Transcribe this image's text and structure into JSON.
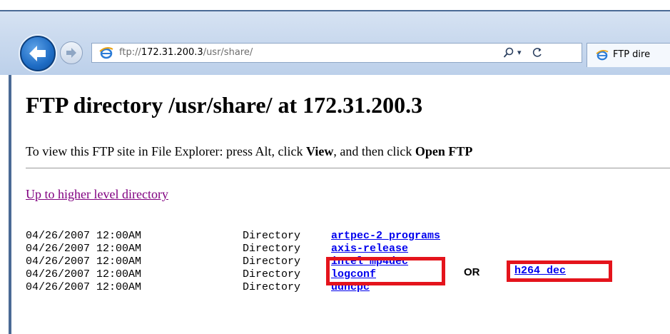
{
  "browser": {
    "address_prefix": "ftp://",
    "address_host": "172.31.200.3",
    "address_path": "/usr/share/",
    "search_icon": "magnifier-icon",
    "dropdown_glyph": "▾",
    "refresh_glyph": "C",
    "tab_label": "FTP dire",
    "accent_color": "#1e6cc4"
  },
  "page": {
    "title": "FTP directory /usr/share/ at 172.31.200.3",
    "info_prefix": "To view this FTP site in File Explorer: press Alt, click ",
    "info_view": "View",
    "info_middle": ", and then click ",
    "info_open": "Open FTP",
    "up_link": "Up to higher level directory"
  },
  "listing": [
    {
      "date": "04/26/2007 12:00AM",
      "kind": "Directory",
      "name": "artpec-2_programs"
    },
    {
      "date": "04/26/2007 12:00AM",
      "kind": "Directory",
      "name": "axis-release"
    },
    {
      "date": "04/26/2007 12:00AM",
      "kind": "Directory",
      "name": "intel_mp4dec"
    },
    {
      "date": "04/26/2007 12:00AM",
      "kind": "Directory",
      "name": "logconf"
    },
    {
      "date": "04/26/2007 12:00AM",
      "kind": "Directory",
      "name": "udhcpc"
    }
  ],
  "annotation": {
    "or_label": "OR",
    "alt_name": "h264_dec",
    "highlight_color": "#e4141c"
  }
}
